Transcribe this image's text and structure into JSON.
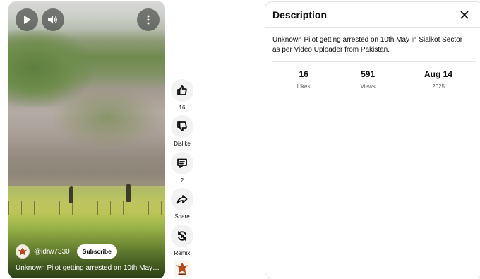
{
  "player": {
    "channel_handle": "@idrw7330",
    "subscribe_label": "Subscribe",
    "video_title": "Unknown Pilot getting arrested on 10th May in ...",
    "controls": {
      "play_icon": "play-icon",
      "volume_icon": "volume-icon",
      "more_icon": "more-vert-icon"
    }
  },
  "actions": {
    "like": {
      "icon": "thumb-up-icon",
      "label": "16"
    },
    "dislike": {
      "icon": "thumb-down-icon",
      "label": "Dislike"
    },
    "comments": {
      "icon": "comment-icon",
      "label": "2"
    },
    "share": {
      "icon": "share-icon",
      "label": "Share"
    },
    "remix": {
      "icon": "remix-icon",
      "label": "Remix"
    }
  },
  "description": {
    "title": "Description",
    "text": "Unknown Pilot getting arrested on 10th May in Sialkot Sector as per Video Uploader from Pakistan.",
    "stats": [
      {
        "value": "16",
        "label": "Likes"
      },
      {
        "value": "591",
        "label": "Views"
      },
      {
        "value": "Aug 14",
        "label": "2025"
      }
    ]
  },
  "colors": {
    "accent_text": "#0f0f0f",
    "secondary_text": "#606060",
    "button_bg": "#f2f2f2",
    "divider": "#e5e5e5"
  }
}
